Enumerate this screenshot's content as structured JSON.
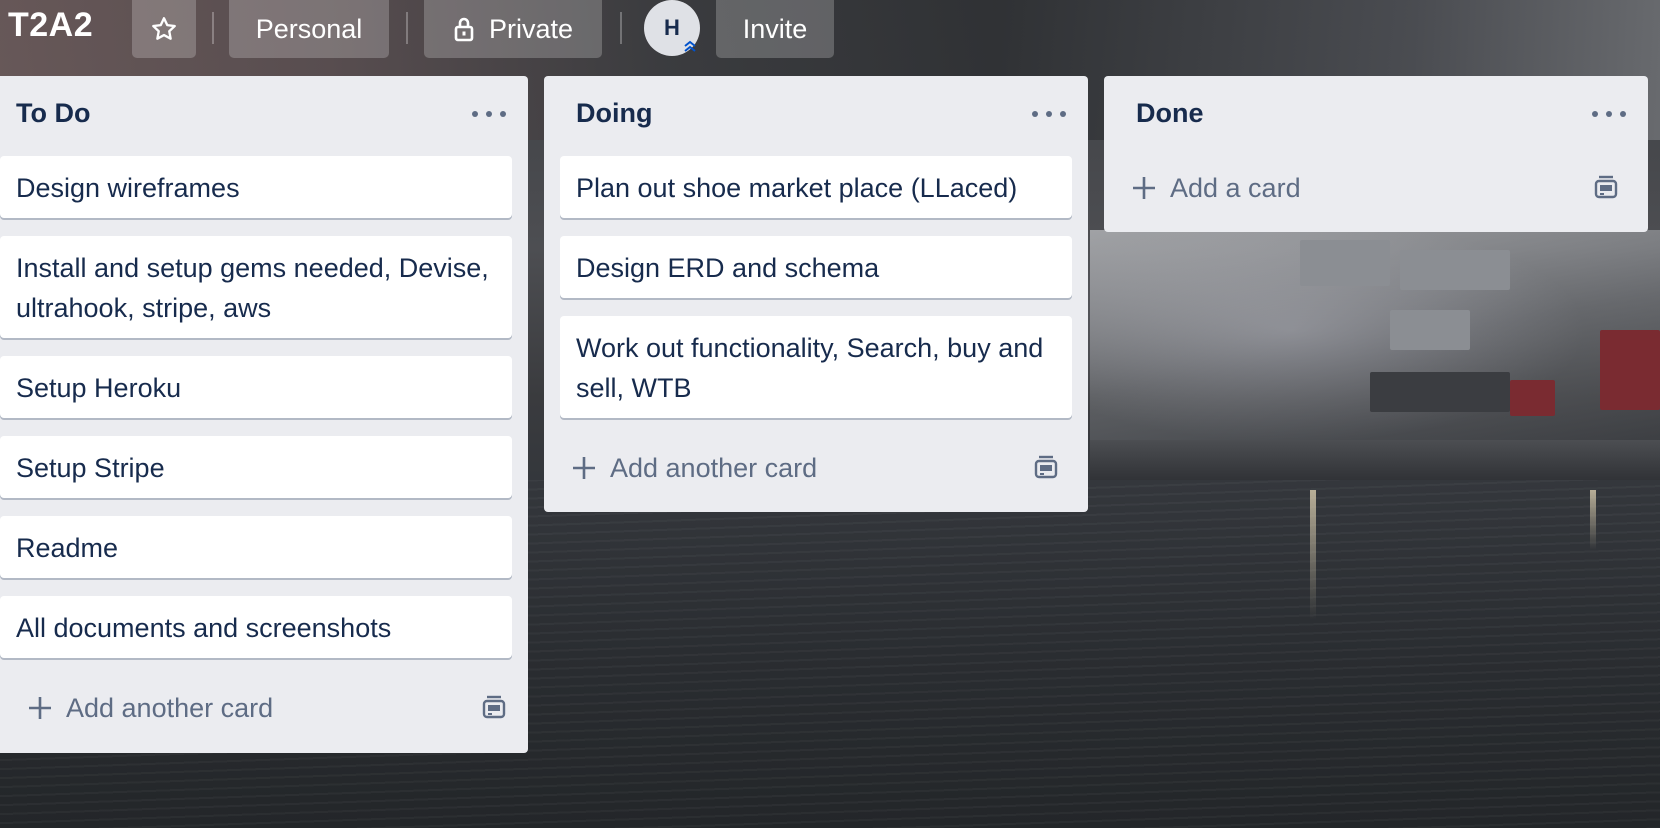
{
  "board": {
    "title": "T2A2",
    "visibility_label": "Personal",
    "privacy_label": "Private",
    "avatar_initial": "H",
    "invite_label": "Invite"
  },
  "lists": [
    {
      "title": "To Do",
      "cards": [
        "Design wireframes",
        "Install and setup gems needed, Devise, ultrahook, stripe, aws",
        "Setup Heroku",
        "Setup Stripe",
        "Readme",
        "All documents and screenshots"
      ],
      "add_label": "Add another card"
    },
    {
      "title": "Doing",
      "cards": [
        "Plan out shoe market place (LLaced)",
        "Design ERD and schema",
        "Work out functionality, Search, buy and sell, WTB"
      ],
      "add_label": "Add another card"
    },
    {
      "title": "Done",
      "cards": [],
      "add_label": "Add a card"
    }
  ],
  "icons": {
    "star": "star-icon",
    "lock": "lock-icon",
    "list_menu": "ellipsis-icon",
    "add": "plus-icon",
    "template": "card-template-icon",
    "avatar_badge": "double-chevron-up-icon"
  },
  "colors": {
    "list_bg": "#ebecf0",
    "card_bg": "#ffffff",
    "text": "#172b4d",
    "muted": "#5e6c84",
    "header_button": "rgba(255,255,255,0.22)"
  }
}
